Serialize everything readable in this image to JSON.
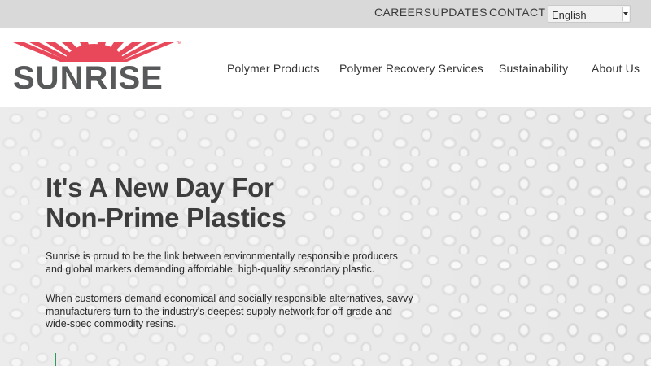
{
  "topbar": {
    "links": [
      "CAREERS",
      "UPDATES",
      "CONTACT"
    ],
    "language": {
      "selected": "English"
    }
  },
  "header": {
    "logo": {
      "text": "SUNRISE",
      "tm": "™",
      "ray_color": "#e9485a",
      "text_color": "#58595b"
    },
    "nav": [
      "Polymer Products",
      "Polymer Recovery Services",
      "Sustainability",
      "About Us"
    ]
  },
  "hero": {
    "title_line1": "It's A New Day For",
    "title_line2": "Non-Prime Plastics",
    "paragraph1_line1": "Sunrise is proud to be the link between environmentally responsible producers",
    "paragraph1_line2": "and global markets demanding affordable, high-quality secondary plastic.",
    "paragraph2_line1": "When customers demand economical and socially responsible alternatives, savvy",
    "paragraph2_line2": "manufacturers turn to the industry's deepest supply network for off-grade and",
    "paragraph2_line3": "wide-spec commodity resins.",
    "accent_color": "#2e9a5a"
  }
}
